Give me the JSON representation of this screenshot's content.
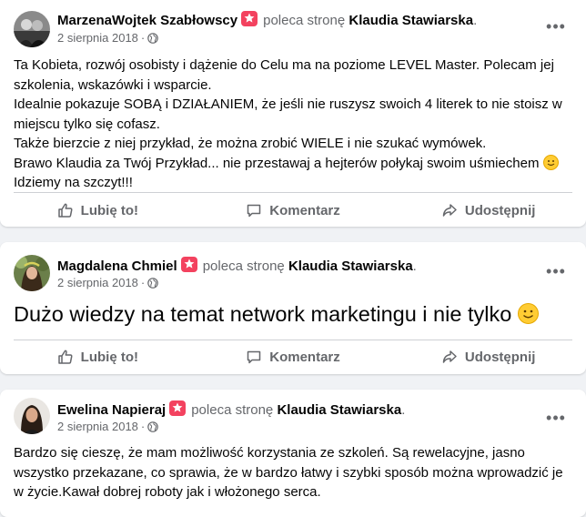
{
  "posts": [
    {
      "author": "MarzenaWojtek Szabłowscy",
      "recommends": "poleca stronę",
      "page": "Klaudia Stawiarska",
      "date": "2 sierpnia 2018",
      "separator": "·",
      "lines": [
        "Ta Kobieta, rozwój osobisty i dążenie do Celu ma na poziome LEVEL Master. Polecam jej szkolenia, wskazówki i wsparcie.",
        "Idealnie pokazuje SOBĄ i DZIAŁANIEM, że jeśli nie ruszysz swoich 4 literek to nie stoisz w miejscu tylko się cofasz.",
        "Także bierzcie z niej przykład, że można zrobić WIELE i nie szukać wymówek.",
        "Brawo Klaudia za Twój Przykład... nie przestawaj a hejterów połykaj swoim uśmiechem",
        "Idziemy na szczyt!!!"
      ]
    },
    {
      "author": "Magdalena Chmiel",
      "recommends": "poleca stronę",
      "page": "Klaudia Stawiarska",
      "date": "2 sierpnia 2018",
      "separator": "·",
      "text": "Dużo wiedzy na temat network marketingu i nie tylko"
    },
    {
      "author": "Ewelina Napieraj",
      "recommends": "poleca stronę",
      "page": "Klaudia Stawiarska",
      "date": "2 sierpnia 2018",
      "separator": "·",
      "text": "Bardzo się cieszę, że mam możliwość korzystania  ze szkoleń. Są rewelacyjne, jasno wszystko przekazane, co sprawia, że w bardzo łatwy i szybki sposób można wprowadzić je w życie.Kawał dobrej roboty jak i włożonego serca."
    }
  ],
  "actions": {
    "like": "Lubię to!",
    "comment": "Komentarz",
    "share": "Udostępnij"
  },
  "more_label": "•••",
  "period": ".",
  "icons": {
    "badge": "recommend-star-icon",
    "globe": "globe-icon",
    "like": "thumbs-up-icon",
    "comment": "comment-icon",
    "share": "share-icon",
    "emoji": "smiling-face-icon"
  },
  "colors": {
    "badge": "#f3425f",
    "muted": "#65676b",
    "background": "#f0f2f5"
  }
}
